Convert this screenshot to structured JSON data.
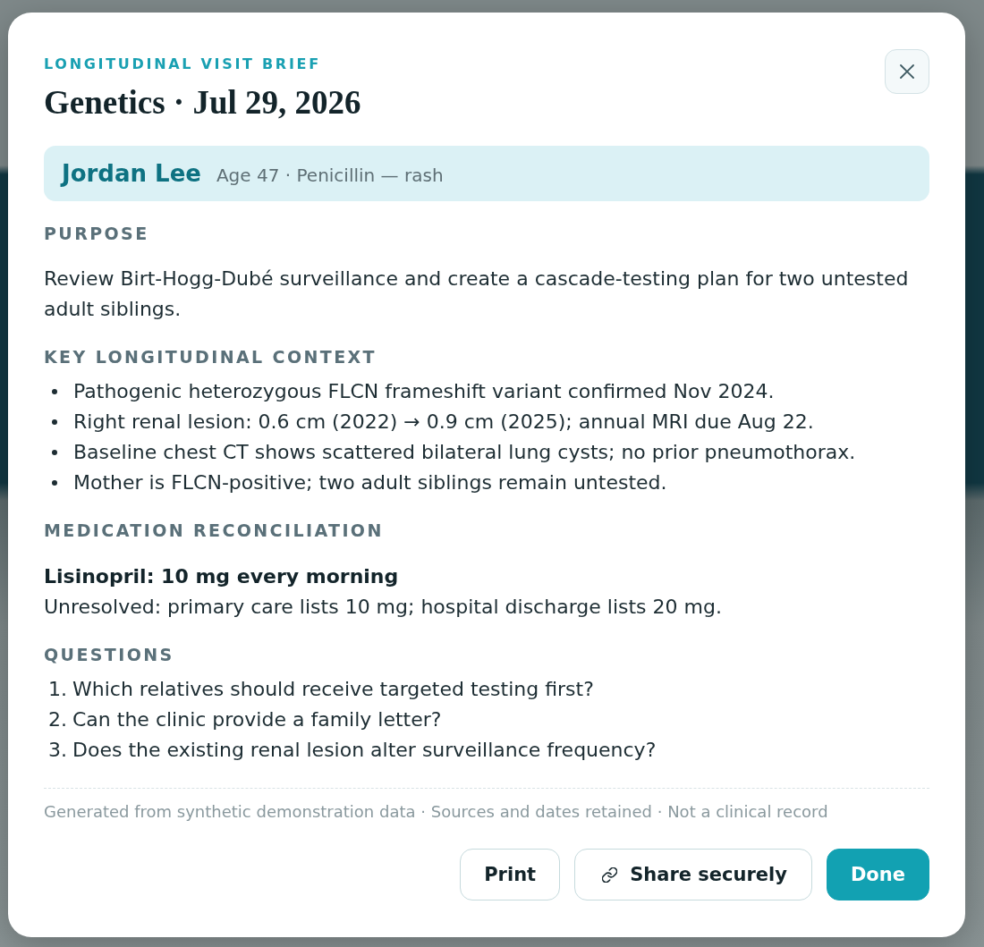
{
  "header": {
    "eyebrow": "LONGITUDINAL VISIT BRIEF",
    "title": "Genetics · Jul 29, 2026"
  },
  "patient": {
    "name": "Jordan Lee",
    "details": "Age 47 · Penicillin — rash"
  },
  "sections": [
    {
      "kind": "paragraph",
      "heading": "PURPOSE",
      "text": "Review Birt-Hogg-Dubé surveillance and create a cascade-testing plan for two untested adult siblings."
    },
    {
      "kind": "bullets",
      "heading": "KEY LONGITUDINAL CONTEXT",
      "items": [
        "Pathogenic heterozygous FLCN frameshift variant confirmed Nov 2024.",
        "Right renal lesion: 0.6 cm (2022) → 0.9 cm (2025); annual MRI due Aug 22.",
        "Baseline chest CT shows scattered bilateral lung cysts; no prior pneumothorax.",
        "Mother is FLCN-positive; two adult siblings remain untested."
      ]
    },
    {
      "kind": "medication",
      "heading": "MEDICATION RECONCILIATION",
      "medication": "Lisinopril: 10 mg every morning",
      "note": "Unresolved: primary care lists 10 mg; hospital discharge lists 20 mg."
    },
    {
      "kind": "numbered",
      "heading": "QUESTIONS",
      "items": [
        {
          "number": "1.",
          "text": "Which relatives should receive targeted testing first?"
        },
        {
          "number": "2.",
          "text": "Can the clinic provide a family letter?"
        },
        {
          "number": "3.",
          "text": "Does the existing renal lesion alter surveillance frequency?"
        }
      ]
    }
  ],
  "footer_note": "Generated from synthetic demonstration data · Sources and dates retained · Not a clinical record",
  "buttons": [
    {
      "label": "Print",
      "kind": "outline"
    },
    {
      "label": "Share securely",
      "kind": "linked"
    },
    {
      "label": "Done",
      "kind": "filled"
    }
  ]
}
